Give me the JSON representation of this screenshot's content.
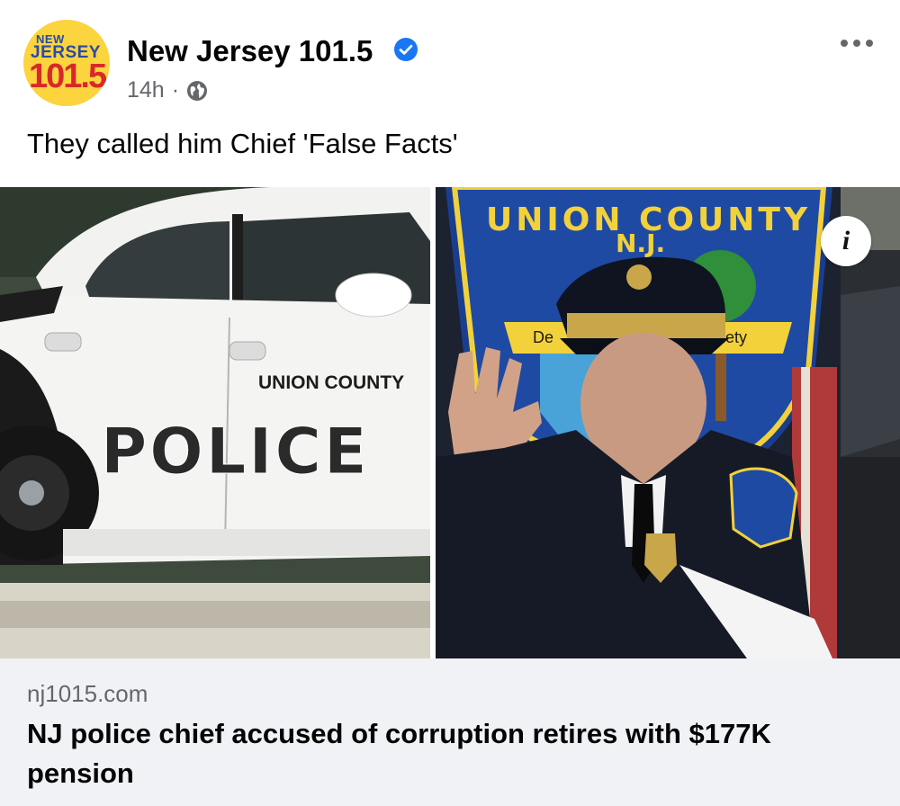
{
  "post": {
    "avatar": {
      "line1": "NEW",
      "line2": "JERSEY",
      "line3": "101.5",
      "colors": {
        "background": "#fbd43e",
        "blue": "#2a4aa8",
        "red": "#d8282a"
      }
    },
    "page_name": "New Jersey 101.5",
    "verified_icon": "verified-badge-icon",
    "timestamp": "14h",
    "separator": "·",
    "audience_icon": "globe-icon",
    "more_icon": "more-options-icon",
    "caption": "They called him Chief 'False Facts'"
  },
  "media": {
    "car_door_text": "UNION COUNTY",
    "car_main_text": "POLICE",
    "patch_top_text": "UNION COUNTY",
    "patch_state_text": "N.J.",
    "patch_banner_left": "De",
    "patch_banner_right": "ety",
    "info_icon": "info-icon",
    "info_label": "i"
  },
  "link_card": {
    "domain": "nj1015.com",
    "headline": "NJ police chief accused of corruption retires with $177K pension",
    "background": "#f0f2f5"
  },
  "colors": {
    "accent": "#1877f2",
    "secondary_text": "#65676b"
  }
}
